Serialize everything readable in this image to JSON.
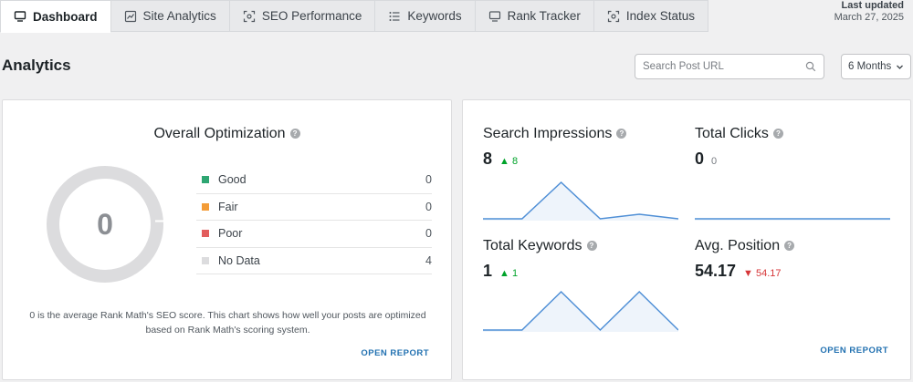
{
  "tabs": [
    {
      "label": "Dashboard",
      "icon": "monitor-icon",
      "active": true
    },
    {
      "label": "Site Analytics",
      "icon": "line-chart-icon",
      "active": false
    },
    {
      "label": "SEO Performance",
      "icon": "scan-icon",
      "active": false
    },
    {
      "label": "Keywords",
      "icon": "list-icon",
      "active": false
    },
    {
      "label": "Rank Tracker",
      "icon": "monitor-icon",
      "active": false
    },
    {
      "label": "Index Status",
      "icon": "scan-icon",
      "active": false
    }
  ],
  "last_updated": {
    "label": "Last updated",
    "date": "March 27, 2025"
  },
  "page_title": "Analytics",
  "search": {
    "placeholder": "Search Post URL"
  },
  "period_select": {
    "value": "6 Months"
  },
  "overall_optimization": {
    "title": "Overall Optimization",
    "score": "0",
    "legend": [
      {
        "label": "Good",
        "value": "0",
        "color": "#2ea672"
      },
      {
        "label": "Fair",
        "value": "0",
        "color": "#f39c37"
      },
      {
        "label": "Poor",
        "value": "0",
        "color": "#e25d5d"
      },
      {
        "label": "No Data",
        "value": "4",
        "color": "#dcdcde"
      }
    ],
    "description": "0 is the average Rank Math's SEO score. This chart shows how well your posts are optimized based on Rank Math's scoring system.",
    "open_report": "OPEN REPORT"
  },
  "metrics": {
    "search_impressions": {
      "title": "Search Impressions",
      "value": "8",
      "delta": "8",
      "trend": "up",
      "spark": [
        0,
        0,
        8,
        0,
        1,
        0
      ]
    },
    "total_clicks": {
      "title": "Total Clicks",
      "value": "0",
      "delta": "0",
      "trend": "neutral",
      "spark": [
        0,
        0,
        0,
        0,
        0,
        0
      ]
    },
    "total_keywords": {
      "title": "Total Keywords",
      "value": "1",
      "delta": "1",
      "trend": "up",
      "spark": [
        0,
        0,
        1,
        0,
        1,
        0
      ]
    },
    "avg_position": {
      "title": "Avg. Position",
      "value": "54.17",
      "delta": "54.17",
      "trend": "down"
    }
  },
  "right_open_report": "OPEN REPORT",
  "colors": {
    "accent": "#2271b1",
    "spark": "#4f8fd6"
  }
}
